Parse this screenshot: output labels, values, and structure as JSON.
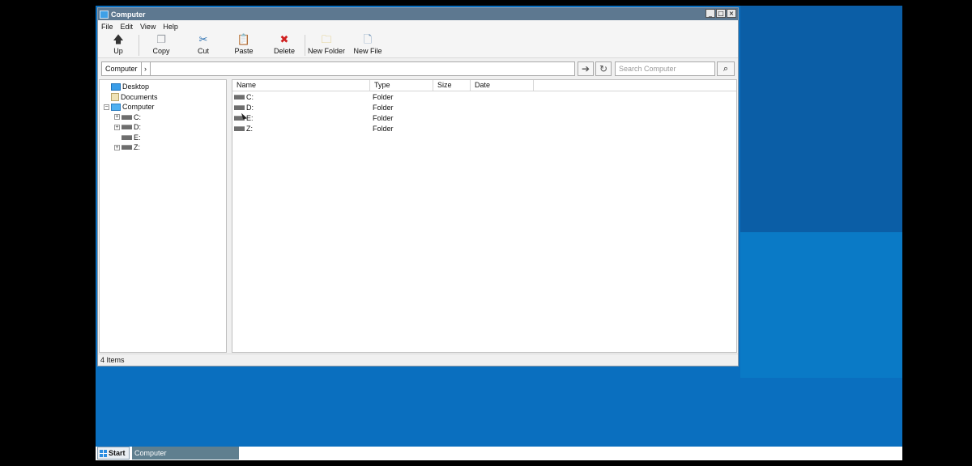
{
  "window": {
    "title": "Computer"
  },
  "menu": [
    "File",
    "Edit",
    "View",
    "Help"
  ],
  "toolbar": [
    {
      "label": "Up",
      "icon": "up-arrow-icon",
      "glyph": "🡅",
      "color": "#333333"
    },
    {
      "label": "Copy",
      "icon": "copy-icon",
      "glyph": "❐",
      "color": "#9aa0a6"
    },
    {
      "label": "Cut",
      "icon": "scissors-icon",
      "glyph": "✂",
      "color": "#2a6fb0"
    },
    {
      "label": "Paste",
      "icon": "paste-icon",
      "glyph": "📋",
      "color": "#b59850"
    },
    {
      "label": "Delete",
      "icon": "delete-icon",
      "glyph": "✖",
      "color": "#d02020"
    },
    {
      "label": "New Folder",
      "icon": "new-folder-icon",
      "glyph": "🗀",
      "color": "#d8b850"
    },
    {
      "label": "New File",
      "icon": "new-file-icon",
      "glyph": "🗋",
      "color": "#6a8fb5"
    }
  ],
  "address": {
    "breadcrumb": "Computer",
    "search_placeholder": "Search Computer"
  },
  "tree": [
    {
      "label": "Desktop",
      "kind": "desktop",
      "indent": 0,
      "expander": ""
    },
    {
      "label": "Documents",
      "kind": "doc",
      "indent": 0,
      "expander": ""
    },
    {
      "label": "Computer",
      "kind": "computer",
      "indent": 0,
      "expander": "−"
    },
    {
      "label": "C:",
      "kind": "drive",
      "indent": 1,
      "expander": "+"
    },
    {
      "label": "D:",
      "kind": "drive",
      "indent": 1,
      "expander": "+"
    },
    {
      "label": "E:",
      "kind": "drive",
      "indent": 1,
      "expander": ""
    },
    {
      "label": "Z:",
      "kind": "drive",
      "indent": 1,
      "expander": "+"
    }
  ],
  "columns": [
    "Name",
    "Type",
    "Size",
    "Date"
  ],
  "files": [
    {
      "name": "C:",
      "type": "Folder"
    },
    {
      "name": "D:",
      "type": "Folder"
    },
    {
      "name": "E:",
      "type": "Folder"
    },
    {
      "name": "Z:",
      "type": "Folder"
    }
  ],
  "status": "4 Items",
  "taskbar": {
    "start": "Start",
    "task": "Computer"
  }
}
